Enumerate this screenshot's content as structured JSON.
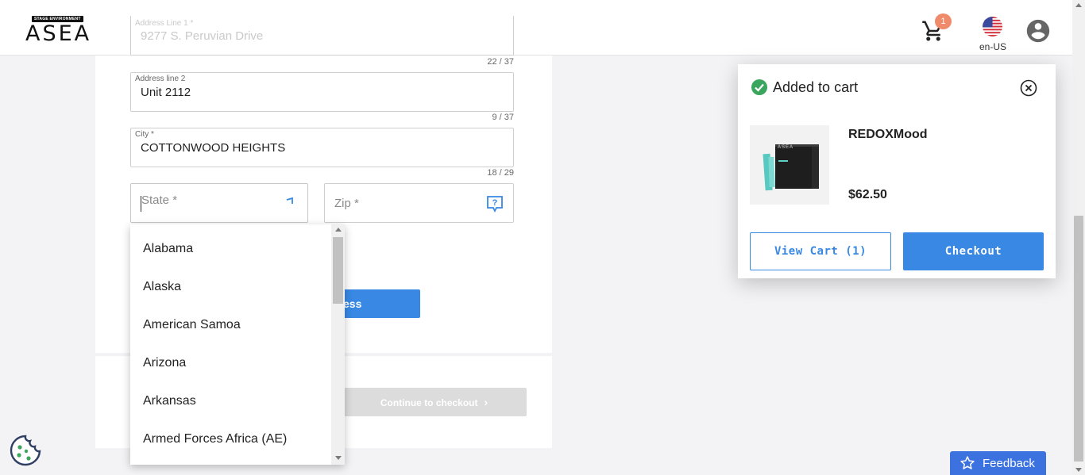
{
  "header": {
    "logo_tag": "STAGE ENVIRONMENT",
    "logo_text": "ASEA",
    "cart_count": "1",
    "locale": "en-US",
    "ghost_field_label": "Address Line 1 *",
    "ghost_field_value": "9277 S. Peruvian Drive"
  },
  "form": {
    "address1_counter": "22 / 37",
    "address2": {
      "label": "Address line 2",
      "value": "Unit 2112",
      "counter": "9 / 37"
    },
    "city": {
      "label": "City *",
      "value": "COTTONWOOD HEIGHTS",
      "counter": "18 / 29"
    },
    "state": {
      "placeholder": "State *"
    },
    "zip": {
      "placeholder": "Zip *"
    },
    "save_button": "ess",
    "continue_button": "Continue to checkout"
  },
  "state_dropdown": {
    "options": [
      "Alabama",
      "Alaska",
      "American Samoa",
      "Arizona",
      "Arkansas",
      "Armed Forces Africa (AE)"
    ]
  },
  "cart_popup": {
    "title": "Added to cart",
    "product_name": "REDOXMood",
    "product_price": "$62.50",
    "view_cart_label": "View Cart (1)",
    "checkout_label": "Checkout",
    "thumb_brand": "ASEA"
  },
  "feedback": {
    "label": "Feedback"
  },
  "colors": {
    "accent": "#3888e4",
    "success": "#3aa55c",
    "badge": "#ef8b6b",
    "feedback": "#3b72e0"
  }
}
